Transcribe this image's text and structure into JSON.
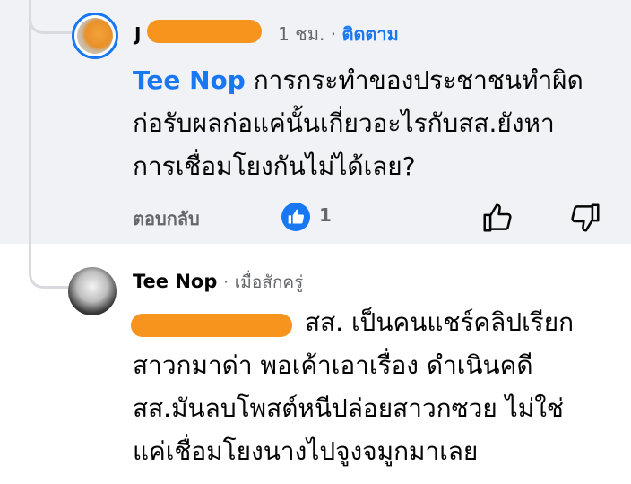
{
  "comment1": {
    "author_visible": "J",
    "time": "1 ชม.",
    "separator": "·",
    "follow_label": "ติดตาม",
    "mention": "Tee Nop",
    "text_line1": " การกระทำของประชาชนทำผิด",
    "text_line2": "ก่อรับผลก่อแค่นั้นเกี่ยวอะไรกับสส.ยังหา",
    "text_line3": "การเชื่อมโยงกันไม่ได้เลย?",
    "reply_label": "ตอบกลับ",
    "like_count": "1",
    "like_icon": "thumbs-up-icon",
    "accent_color": "#1877f2"
  },
  "comment2": {
    "author": "Tee Nop",
    "separator": "·",
    "badge": "เมื่อสักครู่",
    "text_line1": "สส. เป็นคนแชร์คลิปเรียก",
    "text_line2": "สาวกมาด่า พอเค้าเอาเรื่อง ดำเนินคดี",
    "text_line3": "สส.มันลบโพสต์หนีปล่อยสาวกซวย  ไม่ใช่",
    "text_line4": "แค่เชื่อมโยงนางไปจูงจมูกมาเลย"
  },
  "redaction_color": "#f7941d"
}
